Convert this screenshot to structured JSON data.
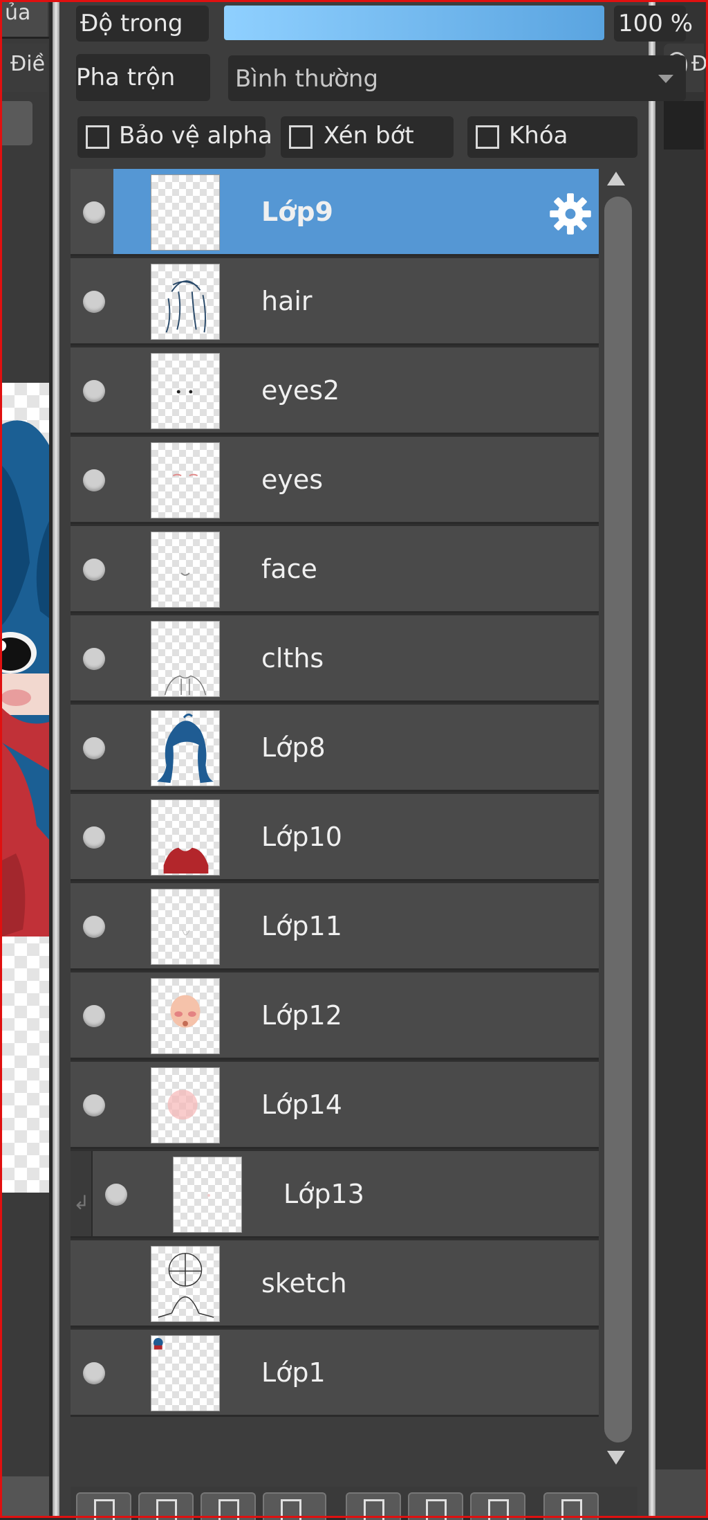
{
  "left_canvas": {
    "tab_top_text": "ủa",
    "tab_row2_text": "Điề"
  },
  "right_strip": {
    "radio_label": "Đ"
  },
  "panel": {
    "opacity_label": "Độ trong",
    "opacity_value": "100 %",
    "opacity_level": 1.0,
    "blend_label": "Pha trộn",
    "blend_value": "Bình thường",
    "protect_alpha_label": "Bảo vệ alpha",
    "clip_label": "Xén bớt",
    "lock_label": "Khóa"
  },
  "layers": [
    {
      "name": "Lớp9",
      "selected": true,
      "visible": true,
      "thumb": "blank"
    },
    {
      "name": "hair",
      "selected": false,
      "visible": true,
      "thumb": "hair-sketch"
    },
    {
      "name": "eyes2",
      "selected": false,
      "visible": true,
      "thumb": "dots"
    },
    {
      "name": "eyes",
      "selected": false,
      "visible": true,
      "thumb": "eyes-pink"
    },
    {
      "name": "face",
      "selected": false,
      "visible": true,
      "thumb": "smile"
    },
    {
      "name": "clths",
      "selected": false,
      "visible": true,
      "thumb": "clothes-line"
    },
    {
      "name": "Lớp8",
      "selected": false,
      "visible": true,
      "thumb": "blue-hair"
    },
    {
      "name": "Lớp10",
      "selected": false,
      "visible": true,
      "thumb": "red-clothes"
    },
    {
      "name": "Lớp11",
      "selected": false,
      "visible": true,
      "thumb": "faint"
    },
    {
      "name": "Lớp12",
      "selected": false,
      "visible": true,
      "thumb": "skin"
    },
    {
      "name": "Lớp14",
      "selected": false,
      "visible": true,
      "thumb": "blush"
    },
    {
      "name": "Lớp13",
      "selected": false,
      "visible": true,
      "clipped": true,
      "thumb": "tiny"
    },
    {
      "name": "sketch",
      "selected": false,
      "visible": false,
      "thumb": "sketch-head"
    },
    {
      "name": "Lớp1",
      "selected": false,
      "visible": true,
      "thumb": "mini-char"
    }
  ],
  "colors": {
    "selected_row": "#5597d4",
    "row_bg": "#4a4a4a",
    "opacity_bar": "#7cc4f8",
    "frame": "#e01010"
  }
}
